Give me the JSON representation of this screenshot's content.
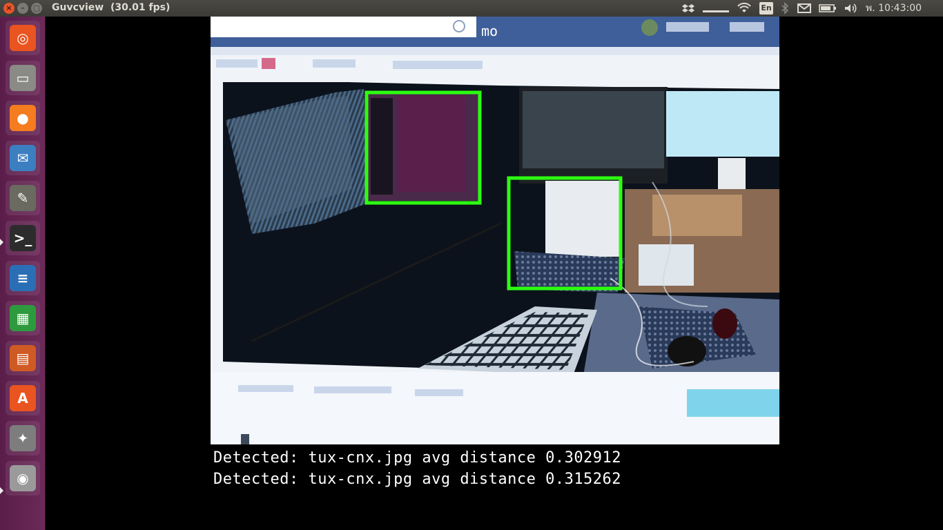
{
  "window": {
    "title": "Guvcview  (30.01 fps)",
    "close_glyph": "×",
    "minimize_glyph": "–",
    "maximize_glyph": "▢"
  },
  "top_panel": {
    "language": "En",
    "clock": "พ. 10:43:00",
    "icons": [
      "dropbox-icon",
      "battery-mini-icon",
      "wifi-icon",
      "bluetooth-icon",
      "mail-icon",
      "battery-icon",
      "volume-icon"
    ],
    "bg_color": "#3c3b37",
    "text_color": "#dfdbd2"
  },
  "launcher": {
    "items": [
      {
        "name": "ubuntu-dash-icon",
        "glyph": "◎",
        "color": "#e95420"
      },
      {
        "name": "files-icon",
        "glyph": "▭",
        "color": "#8a8a86"
      },
      {
        "name": "firefox-icon",
        "glyph": "●",
        "color": "#f57c1f"
      },
      {
        "name": "thunderbird-icon",
        "glyph": "✉",
        "color": "#3c7fc1"
      },
      {
        "name": "gimp-icon",
        "glyph": "✎",
        "color": "#6a6a60"
      },
      {
        "name": "terminal-icon",
        "glyph": ">_",
        "color": "#2c2c2c"
      },
      {
        "name": "writer-icon",
        "glyph": "≡",
        "color": "#2a6fb5"
      },
      {
        "name": "calc-icon",
        "glyph": "▦",
        "color": "#2e9a3e"
      },
      {
        "name": "impress-icon",
        "glyph": "▤",
        "color": "#d05a24"
      },
      {
        "name": "software-center-icon",
        "glyph": "A",
        "color": "#e95420"
      },
      {
        "name": "settings-icon",
        "glyph": "✦",
        "color": "#7d7d7d"
      },
      {
        "name": "webcam-icon",
        "glyph": "◉",
        "color": "#9a9a9a"
      }
    ]
  },
  "console": {
    "lines": [
      "Detected: tux-cnx.jpg avg distance 0.302912",
      "Detected: tux-cnx.jpg avg distance 0.315262"
    ]
  },
  "detection": {
    "box_color": "#2cff10"
  },
  "feed_text": {
    "header_fragment": "mo"
  }
}
